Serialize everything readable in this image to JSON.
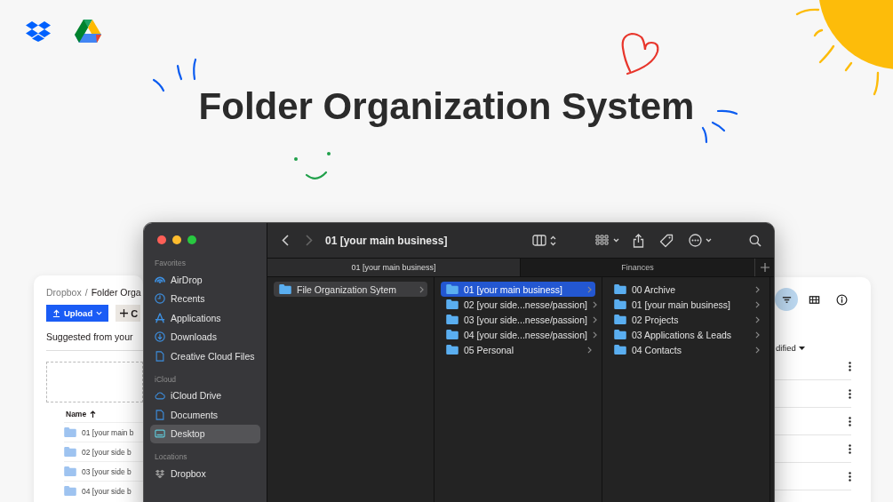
{
  "headline": "Folder Organization System",
  "dropbox_card": {
    "breadcrumb": [
      "Dropbox",
      "/",
      "Folder Orga"
    ],
    "upload_button": "Upload",
    "create_button": "C",
    "suggestion": "Suggested from your",
    "name_header": "Name",
    "rows": [
      "01 [your main b",
      "02 [your side b",
      "03 [your side b",
      "04 [your side b"
    ]
  },
  "finder": {
    "title": "01 [your main business]",
    "back_enabled": true,
    "forward_enabled": false,
    "sidebar": [
      {
        "heading": "Favorites",
        "items": [
          {
            "label": "AirDrop",
            "kind": "airdrop",
            "selected": false
          },
          {
            "label": "Recents",
            "kind": "clock",
            "selected": false
          },
          {
            "label": "Applications",
            "kind": "apps",
            "selected": false
          },
          {
            "label": "Downloads",
            "kind": "download",
            "selected": false
          },
          {
            "label": "Creative Cloud Files",
            "kind": "document",
            "selected": false
          }
        ]
      },
      {
        "heading": "iCloud",
        "items": [
          {
            "label": "iCloud Drive",
            "kind": "cloud",
            "selected": false
          },
          {
            "label": "Documents",
            "kind": "document",
            "selected": false
          },
          {
            "label": "Desktop",
            "kind": "desktop",
            "selected": true
          }
        ]
      },
      {
        "heading": "Locations",
        "items": [
          {
            "label": "Dropbox",
            "kind": "boxes",
            "selected": false
          }
        ]
      }
    ],
    "tabs": [
      {
        "label": "01 [your main business]",
        "selected": true
      },
      {
        "label": "Finances",
        "selected": false
      }
    ],
    "columns": [
      [
        {
          "label": "File Organization Sytem",
          "selected": true
        }
      ],
      [
        {
          "label": "01 [your main business]",
          "selected": true
        },
        {
          "label": "02 [your side...nesse/passion]",
          "selected": false
        },
        {
          "label": "03 [your side...nesse/passion]",
          "selected": false
        },
        {
          "label": "04 [your side...nesse/passion]",
          "selected": false
        },
        {
          "label": "05 Personal",
          "selected": false
        }
      ],
      [
        {
          "label": "00 Archive",
          "selected": false
        },
        {
          "label": "01 [your main business]",
          "selected": false
        },
        {
          "label": "02 Projects",
          "selected": false
        },
        {
          "label": "03 Applications & Leads",
          "selected": false
        },
        {
          "label": "04 Contacts",
          "selected": false
        }
      ]
    ]
  },
  "right_card": {
    "tools": [
      {
        "kind": "filter",
        "selected": true
      },
      {
        "kind": "grid",
        "selected": false
      },
      {
        "kind": "info",
        "selected": false
      }
    ],
    "sort_header": "dified"
  }
}
